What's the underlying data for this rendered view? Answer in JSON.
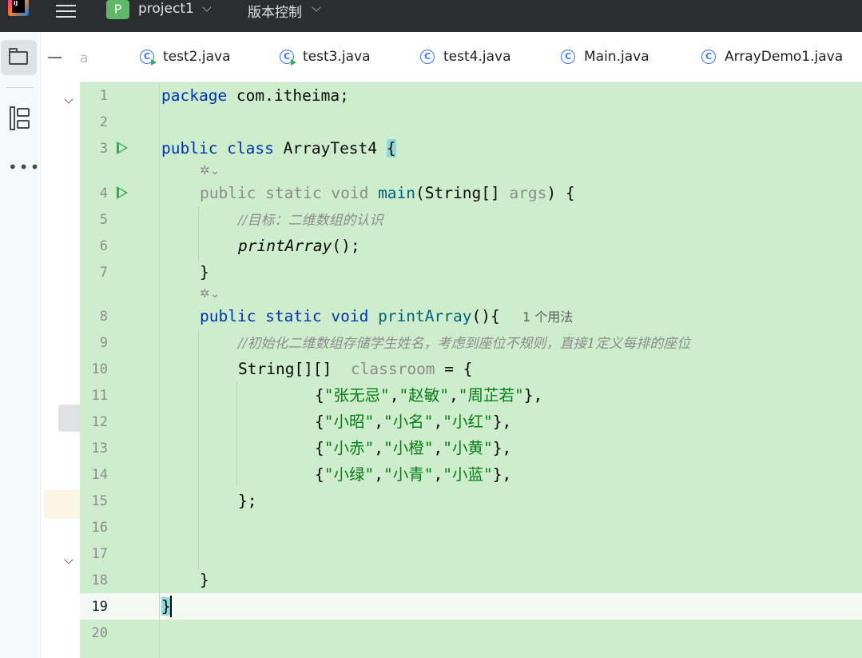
{
  "topbar": {
    "project_badge": "P",
    "project_name": "project1",
    "vcs_label": "版本控制"
  },
  "tabs": [
    {
      "label": "a",
      "partial": true
    },
    {
      "label": "test2.java",
      "icon": "java-class-runnable-icon"
    },
    {
      "label": "test3.java",
      "icon": "java-class-runnable-icon"
    },
    {
      "label": "test4.java",
      "icon": "java-class-icon"
    },
    {
      "label": "Main.java",
      "icon": "java-class-icon"
    },
    {
      "label": "ArrayDemo1.java",
      "icon": "java-class-icon"
    }
  ],
  "editor": {
    "line_numbers": [
      "1",
      "2",
      "3",
      "4",
      "5",
      "6",
      "7",
      "8",
      "9",
      "10",
      "11",
      "12",
      "13",
      "14",
      "15",
      "16",
      "17",
      "18",
      "19",
      "20"
    ],
    "current_line": 19,
    "code": {
      "l1_kw": "package",
      "l1_rest": " com.itheima;",
      "l3_kw": "public class",
      "l3_name": " ArrayTest4 ",
      "l3_brace": "{",
      "l4_kw": "public static void",
      "l4_fn": " main",
      "l4_p1": "(String[] ",
      "l4_param": "args",
      "l4_p2": ") {",
      "l5_comment": "//目标：二维数组的认识",
      "l6_call": "printArray",
      "l6_rest": "();",
      "l7": "}",
      "l8_kw": "public static void",
      "l8_fn": " printArray",
      "l8_rest": "(){",
      "l8_hint": "1 个用法",
      "l9_comment": "//初始化二维数组存储学生姓名，考虑到座位不规则，直接1定义每排的座位",
      "l10_type": "String[][]  ",
      "l10_var": "classroom",
      "l10_rest": " = {",
      "rows": [
        [
          "\"张无忌\"",
          "\"赵敏\"",
          "\"周芷若\""
        ],
        [
          "\"小昭\"",
          "\"小名\"",
          "\"小红\""
        ],
        [
          "\"小赤\"",
          "\"小橙\"",
          "\"小黄\""
        ],
        [
          "\"小绿\"",
          "\"小青\"",
          "\"小蓝\""
        ]
      ],
      "l15": "};",
      "l18": "}",
      "l19": "}"
    }
  }
}
